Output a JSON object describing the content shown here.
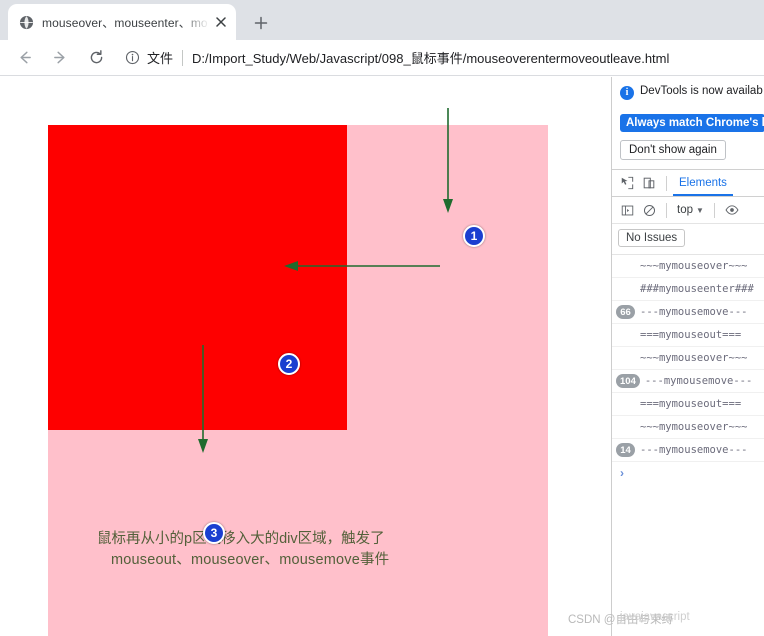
{
  "browser": {
    "tab": {
      "title": "mouseover、mouseenter、mo",
      "favicon_icon": "globe-icon",
      "close_icon": "close-icon"
    },
    "new_tab_label": "+",
    "toolbar": {
      "back_icon": "back-arrow-icon",
      "forward_icon": "forward-arrow-icon",
      "reload_icon": "reload-icon",
      "info_icon": "info-circle-icon",
      "scheme_label": "文件",
      "url": "D:/Import_Study/Web/Javascript/098_鼠标事件/mouseoverentermoveoutleave.html"
    }
  },
  "page": {
    "red_box_color": "#fe0000",
    "pink_div_color": "#ffc0cb",
    "caption_line1": "鼠标再从小的p区域移入大的div区域，触发了",
    "caption_line2": "mouseout、mouseover、mousemove事件",
    "caption_color": "#53603a",
    "markers": [
      {
        "label": "1"
      },
      {
        "label": "2"
      },
      {
        "label": "3"
      }
    ],
    "arrow_color": "#1f6b2e"
  },
  "devtools": {
    "notice_text": "DevTools is now availab",
    "notice_icon": "info-circle-icon",
    "primary_button": "Always match Chrome's la",
    "secondary_button": "Don't show again",
    "inspect_icon": "inspect-cursor-icon",
    "device_icon": "device-toolbar-icon",
    "tabs": [
      {
        "label": "Elements",
        "active": true
      }
    ],
    "sidebar": {
      "sidebar_icon": "console-sidebar-icon",
      "clear_icon": "clear-console-icon",
      "context_label": "top",
      "caret_icon": "chevron-down-icon",
      "eye_icon": "eye-icon"
    },
    "issues_label": "No Issues",
    "prompt_icon": "chevron-right-icon",
    "console_logs": [
      {
        "badge": "",
        "text": "~~~mymouseover~~~"
      },
      {
        "badge": "",
        "text": "###mymouseenter###"
      },
      {
        "badge": "66",
        "text": "---mymousemove---"
      },
      {
        "badge": "",
        "text": "===mymouseout==="
      },
      {
        "badge": "",
        "text": "~~~mymouseover~~~"
      },
      {
        "badge": "104",
        "text": "---mymousemove---"
      },
      {
        "badge": "",
        "text": "===mymouseout==="
      },
      {
        "badge": "",
        "text": "~~~mymouseover~~~"
      },
      {
        "badge": "14",
        "text": "---mymousemove---"
      }
    ]
  },
  "watermark": {
    "text": "CSDN @自由与束缚",
    "overlay_text": "javajavascript"
  }
}
